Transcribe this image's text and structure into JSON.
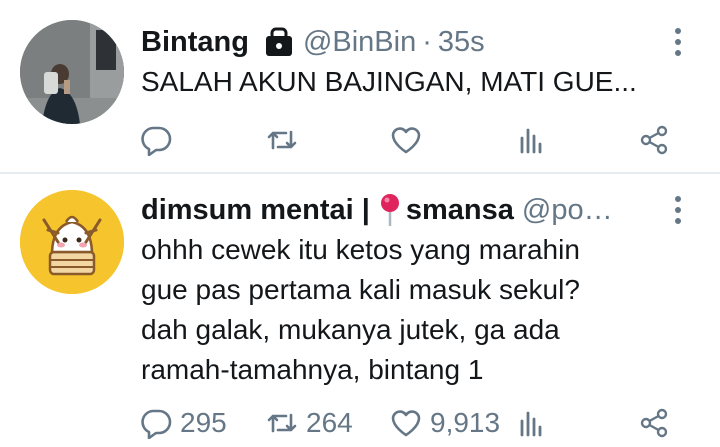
{
  "tweets": [
    {
      "name": "Bintang",
      "handle": "@BinBin",
      "separator": "·",
      "time": "35s",
      "protected_icon": "lock-icon",
      "text_lines": [
        "SALAH AKUN BAJINGAN, MATI GUE..."
      ],
      "actions": {
        "reply": "",
        "retweet": "",
        "like": "",
        "analytics": "",
        "share": ""
      }
    },
    {
      "name_part1": "dimsum mentai |",
      "name_icon": "round-pushpin-icon",
      "name_part2": "smansa",
      "handle": "@po…",
      "text_lines": [
        "ohhh cewek itu ketos yang marahin",
        "gue pas pertama kali masuk sekul?",
        "dah galak, mukanya jutek, ga ada",
        "ramah-tamahnya, bintang 1"
      ],
      "actions": {
        "reply": "295",
        "retweet": "264",
        "like": "9,913",
        "analytics": "",
        "share": ""
      }
    }
  ],
  "colors": {
    "text": "#14171a",
    "secondary": "#657786",
    "divider": "#e6ecf0",
    "avatar2_bg": "#f6c42c",
    "pin": "#e0245e"
  }
}
